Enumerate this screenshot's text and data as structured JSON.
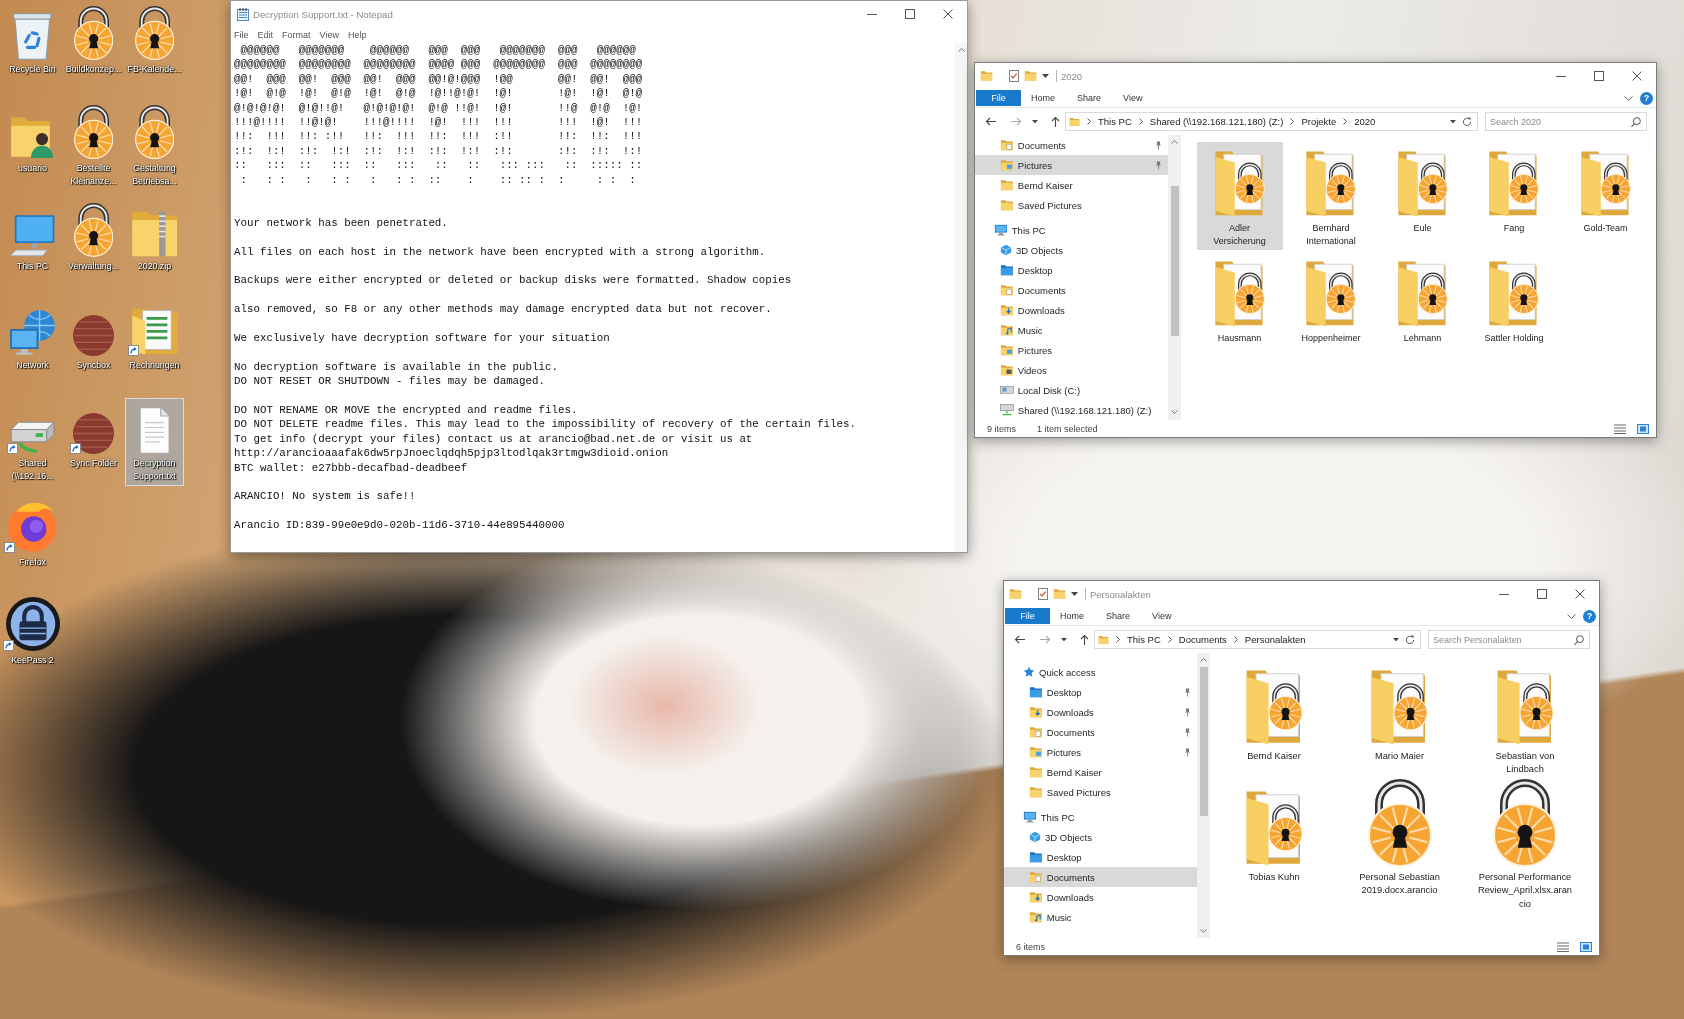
{
  "desktop": {
    "columns": [
      [
        {
          "label": "Recycle Bin",
          "kind": "recycle_bin",
          "shortcut": false,
          "selected": false
        },
        {
          "label": "usuario",
          "kind": "user_folder",
          "shortcut": false,
          "selected": false
        },
        {
          "label": "This PC",
          "kind": "computer",
          "shortcut": false,
          "selected": false
        },
        {
          "label": "Network",
          "kind": "network",
          "shortcut": false,
          "selected": false
        },
        {
          "label": "Shared (\\\\192.16...",
          "kind": "drive",
          "shortcut": true,
          "selected": false
        },
        {
          "label": "Firefox",
          "kind": "browser",
          "shortcut": true,
          "selected": false
        },
        {
          "label": "KeePass 2",
          "kind": "keepass",
          "shortcut": true,
          "selected": false
        }
      ],
      [
        {
          "label": "Buildkonzep...",
          "kind": "padlock",
          "shortcut": false,
          "selected": false
        },
        {
          "label": "Bestellte Kleinanze...",
          "kind": "padlock",
          "shortcut": false,
          "selected": false
        },
        {
          "label": "Verwaltung...",
          "kind": "padlock",
          "shortcut": false,
          "selected": false
        },
        {
          "label": "Syncbox",
          "kind": "sphere",
          "shortcut": false,
          "selected": false
        },
        {
          "label": "Sync Folder",
          "kind": "sphere",
          "shortcut": true,
          "selected": false
        }
      ],
      [
        {
          "label": "FB-Kalende...",
          "kind": "padlock",
          "shortcut": false,
          "selected": false
        },
        {
          "label": "Gestaltung Betriebsa...",
          "kind": "padlock",
          "shortcut": false,
          "selected": false
        },
        {
          "label": "2020.zip",
          "kind": "zip_folder",
          "shortcut": false,
          "selected": false
        },
        {
          "label": "Rechnungen",
          "kind": "spreadsheet_folder",
          "shortcut": true,
          "selected": false
        },
        {
          "label": "Decryption Support.txt",
          "kind": "text_file",
          "shortcut": false,
          "selected": true
        }
      ]
    ]
  },
  "notepad": {
    "title": "Decryption Support.txt - Notepad",
    "menu": [
      "File",
      "Edit",
      "Format",
      "View",
      "Help"
    ],
    "ascii_art": [
      " @@@@@@   @@@@@@@    @@@@@@   @@@  @@@   @@@@@@@  @@@   @@@@@@",
      "@@@@@@@@  @@@@@@@@  @@@@@@@@  @@@@ @@@  @@@@@@@@  @@@  @@@@@@@@",
      "@@!  @@@  @@!  @@@  @@!  @@@  @@!@!@@@  !@@       @@!  @@!  @@@",
      "!@!  @!@  !@!  @!@  !@!  @!@  !@!!@!@!  !@!       !@!  !@!  @!@",
      "@!@!@!@!  @!@!!@!   @!@!@!@!  @!@ !!@!  !@!       !!@  @!@  !@!",
      "!!!@!!!!  !!@!@!    !!!@!!!!  !@!  !!!  !!!       !!!  !@!  !!!",
      "!!:  !!!  !!: :!!   !!:  !!!  !!:  !!!  :!!       !!:  !!:  !!!",
      ":!:  !:!  :!:  !:!  :!:  !:!  :!:  !:!  :!:       :!:  :!:  !:!",
      "::   :::  ::   :::  ::   :::   ::   ::   ::: :::   ::  ::::: ::",
      " :   : :   :   : :   :   : :  ::    :    :: :: :  :     : :  :"
    ],
    "paragraphs": [
      [
        "Your network has been penetrated."
      ],
      [
        "All files on each host in the network have been encrypted with a strong algorithm."
      ],
      [
        "Backups were either encrypted or deleted or backup disks were formatted. Shadow copies"
      ],
      [
        "also removed, so F8 or any other methods may damage encrypted data but not recover."
      ],
      [
        "We exclusively have decryption software for your situation"
      ],
      [
        "No decryption software is available in the public.",
        "DO NOT RESET OR SHUTDOWN - files may be damaged."
      ],
      [
        "DO NOT RENAME OR MOVE the encrypted and readme files.",
        "DO NOT DELETE readme files. This may lead to the impossibility of recovery of the certain files.",
        "To get info (decrypt your files) contact us at arancio@bad.net.de or visit us at",
        "http://arancioaaafak6dw5rpJnoeclqdqh5pjp3ltodlqak3rtmgw3dioid.onion",
        "BTC wallet: e27bbb-decafbad-deadbeef"
      ],
      [
        "ARANCIO! No system is safe!!"
      ],
      [
        "Arancio ID:839-99e0e9d0-020b-11d6-3710-44e895440000"
      ]
    ]
  },
  "explorer_windows": [
    {
      "title": "2020",
      "ribbon_tabs": [
        {
          "label": "File",
          "kind": "menu"
        },
        {
          "label": "Home",
          "kind": "tab"
        },
        {
          "label": "Share",
          "kind": "tab"
        },
        {
          "label": "View",
          "kind": "tab"
        }
      ],
      "help": "?",
      "breadcrumb": [
        "This PC",
        "Shared (\\\\192.168.121.180) (Z:)",
        "Projekte",
        "2020"
      ],
      "search": {
        "placeholder": "Search 2020"
      },
      "nav": [
        {
          "children": [
            {
              "label": "Documents",
              "kind": "documents",
              "pinned": true,
              "selected": false
            },
            {
              "label": "Pictures",
              "kind": "pictures",
              "pinned": true,
              "selected": true
            },
            {
              "label": "Bernd Kaiser",
              "kind": "folder",
              "pinned": false,
              "selected": false
            },
            {
              "label": "Saved Pictures",
              "kind": "folder",
              "pinned": false,
              "selected": false
            }
          ]
        },
        {
          "label": "This PC",
          "kind": "pc",
          "selected": false,
          "children": [
            {
              "label": "3D Objects",
              "kind": "objects3d",
              "pinned": false,
              "selected": false
            },
            {
              "label": "Desktop",
              "kind": "desktop",
              "pinned": false,
              "selected": false
            },
            {
              "label": "Documents",
              "kind": "documents",
              "pinned": false,
              "selected": false
            },
            {
              "label": "Downloads",
              "kind": "downloads",
              "pinned": false,
              "selected": false
            },
            {
              "label": "Music",
              "kind": "music",
              "pinned": false,
              "selected": false
            },
            {
              "label": "Pictures",
              "kind": "pictures",
              "pinned": false,
              "selected": false
            },
            {
              "label": "Videos",
              "kind": "videos",
              "pinned": false,
              "selected": false
            },
            {
              "label": "Local Disk (C:)",
              "kind": "disk",
              "pinned": false,
              "selected": false
            },
            {
              "label": "Shared (\\\\192.168.121.180) (Z:)",
              "kind": "network_drive",
              "pinned": false,
              "selected": false
            }
          ]
        }
      ],
      "items": [
        {
          "label": "Adler Versicherung",
          "kind": "locked_folder",
          "selected": true
        },
        {
          "label": "Bernhard International",
          "kind": "locked_folder",
          "selected": false
        },
        {
          "label": "Eule",
          "kind": "locked_folder",
          "selected": false
        },
        {
          "label": "Fang",
          "kind": "locked_folder",
          "selected": false
        },
        {
          "label": "Gold-Team",
          "kind": "locked_folder",
          "selected": false
        },
        {
          "label": "Hausmann",
          "kind": "locked_folder",
          "selected": false
        },
        {
          "label": "Hoppenheimer",
          "kind": "locked_folder",
          "selected": false
        },
        {
          "label": "Lehmann",
          "kind": "locked_folder",
          "selected": false
        },
        {
          "label": "Sattler Holding",
          "kind": "locked_folder",
          "selected": false
        }
      ],
      "status": [
        "9 items",
        "1 item selected"
      ]
    },
    {
      "title": "Personalakten",
      "ribbon_tabs": [
        {
          "label": "File",
          "kind": "menu"
        },
        {
          "label": "Home",
          "kind": "tab"
        },
        {
          "label": "Share",
          "kind": "tab"
        },
        {
          "label": "View",
          "kind": "tab"
        }
      ],
      "help": "?",
      "breadcrumb": [
        "This PC",
        "Documents",
        "Personalakten"
      ],
      "search": {
        "placeholder": "Search Personalakten"
      },
      "nav": [
        {
          "label": "Quick access",
          "kind": "quick_access",
          "selected": false,
          "children": [
            {
              "label": "Desktop",
              "kind": "desktop",
              "pinned": true,
              "selected": false
            },
            {
              "label": "Downloads",
              "kind": "downloads",
              "pinned": true,
              "selected": false
            },
            {
              "label": "Documents",
              "kind": "documents",
              "pinned": true,
              "selected": false
            },
            {
              "label": "Pictures",
              "kind": "pictures",
              "pinned": true,
              "selected": false
            },
            {
              "label": "Bernd Kaiser",
              "kind": "folder",
              "pinned": false,
              "selected": false
            },
            {
              "label": "Saved Pictures",
              "kind": "folder",
              "pinned": false,
              "selected": false
            }
          ]
        },
        {
          "label": "This PC",
          "kind": "pc",
          "selected": false,
          "children": [
            {
              "label": "3D Objects",
              "kind": "objects3d",
              "pinned": false,
              "selected": false
            },
            {
              "label": "Desktop",
              "kind": "desktop",
              "pinned": false,
              "selected": false
            },
            {
              "label": "Documents",
              "kind": "documents",
              "pinned": false,
              "selected": true
            },
            {
              "label": "Downloads",
              "kind": "downloads",
              "pinned": false,
              "selected": false
            },
            {
              "label": "Music",
              "kind": "music",
              "pinned": false,
              "selected": false
            }
          ]
        }
      ],
      "items": [
        {
          "label": "Bernd Kaiser",
          "kind": "locked_folder",
          "selected": false
        },
        {
          "label": "Mario Maier",
          "kind": "locked_folder",
          "selected": false
        },
        {
          "label": "Sebastian von Lindbach",
          "kind": "locked_folder",
          "selected": false
        },
        {
          "label": "Tobias Kuhn",
          "kind": "locked_folder",
          "selected": false
        },
        {
          "label": "Personal Sebastian 2019.docx.arancio",
          "kind": "locked_file",
          "selected": false
        },
        {
          "label": "Personal Performance Review_April.xlsx.arancio",
          "kind": "locked_file",
          "selected": false
        }
      ],
      "status": [
        "6 items"
      ]
    }
  ]
}
